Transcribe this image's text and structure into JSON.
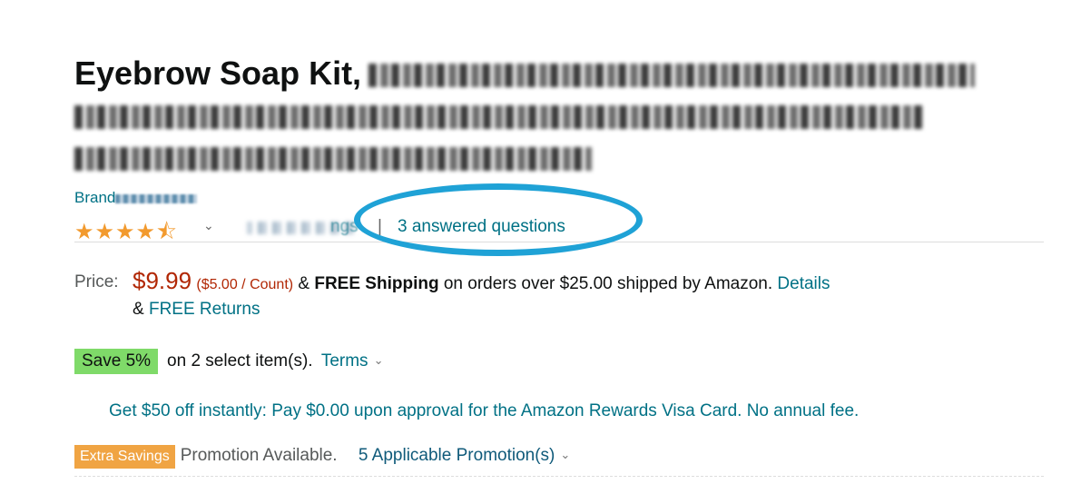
{
  "product": {
    "title_visible": "Eyebrow Soap Kit,",
    "brand_label": "Brand",
    "rating_stars": "★★★★⯪",
    "ratings_tail": "ngs",
    "separator": "|",
    "answered_questions": "3 answered questions"
  },
  "price": {
    "label": "Price:",
    "value": "$9.99",
    "unit": "($5.00 / Count)",
    "amp": "&",
    "shipping_bold": "FREE Shipping",
    "shipping_rest": "on orders over $25.00 shipped by Amazon.",
    "details_link": "Details",
    "returns_amp": "&",
    "returns_link": "FREE Returns"
  },
  "save": {
    "badge": "Save 5%",
    "text": "on 2 select item(s).",
    "terms": "Terms"
  },
  "visa_offer": "Get $50 off instantly: Pay $0.00 upon approval for the Amazon Rewards Visa Card. No annual fee.",
  "extra": {
    "badge": "Extra Savings",
    "promo_text": "Promotion Available.",
    "applicable": "5 Applicable Promotion(s)"
  },
  "colors": {
    "link": "#007185",
    "price": "#b12704",
    "stars": "#f29a2e",
    "save_badge": "#7fda69",
    "extra_badge": "#f0a443",
    "annotation_oval": "#1fa2d6"
  }
}
